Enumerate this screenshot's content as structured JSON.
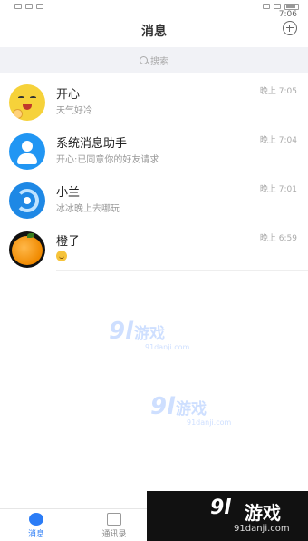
{
  "status_bar": {
    "time": "7:06"
  },
  "header": {
    "title": "消息"
  },
  "search": {
    "placeholder": "搜索"
  },
  "conversations": [
    {
      "name": "开心",
      "message": "天气好冷",
      "time": "晚上 7:05"
    },
    {
      "name": "系统消息助手",
      "message": "开心:已同意你的好友请求",
      "time": "晚上 7:04"
    },
    {
      "name": "小兰",
      "message": "冰冰晚上去哪玩",
      "time": "晚上 7:01"
    },
    {
      "name": "橙子",
      "message": "",
      "time": "晚上 6:59"
    }
  ],
  "watermark": {
    "logo": "9l",
    "cn": "游戏",
    "site": "91danji.com"
  },
  "tabs": [
    {
      "label": "消息"
    },
    {
      "label": "通讯录"
    }
  ],
  "colors": {
    "accent": "#2b7cf6",
    "divider": "#eeeeee",
    "search_bg": "#f1f2f6"
  },
  "icons": [
    "add-icon",
    "search-icon",
    "message-tab-icon",
    "contacts-tab-icon"
  ]
}
